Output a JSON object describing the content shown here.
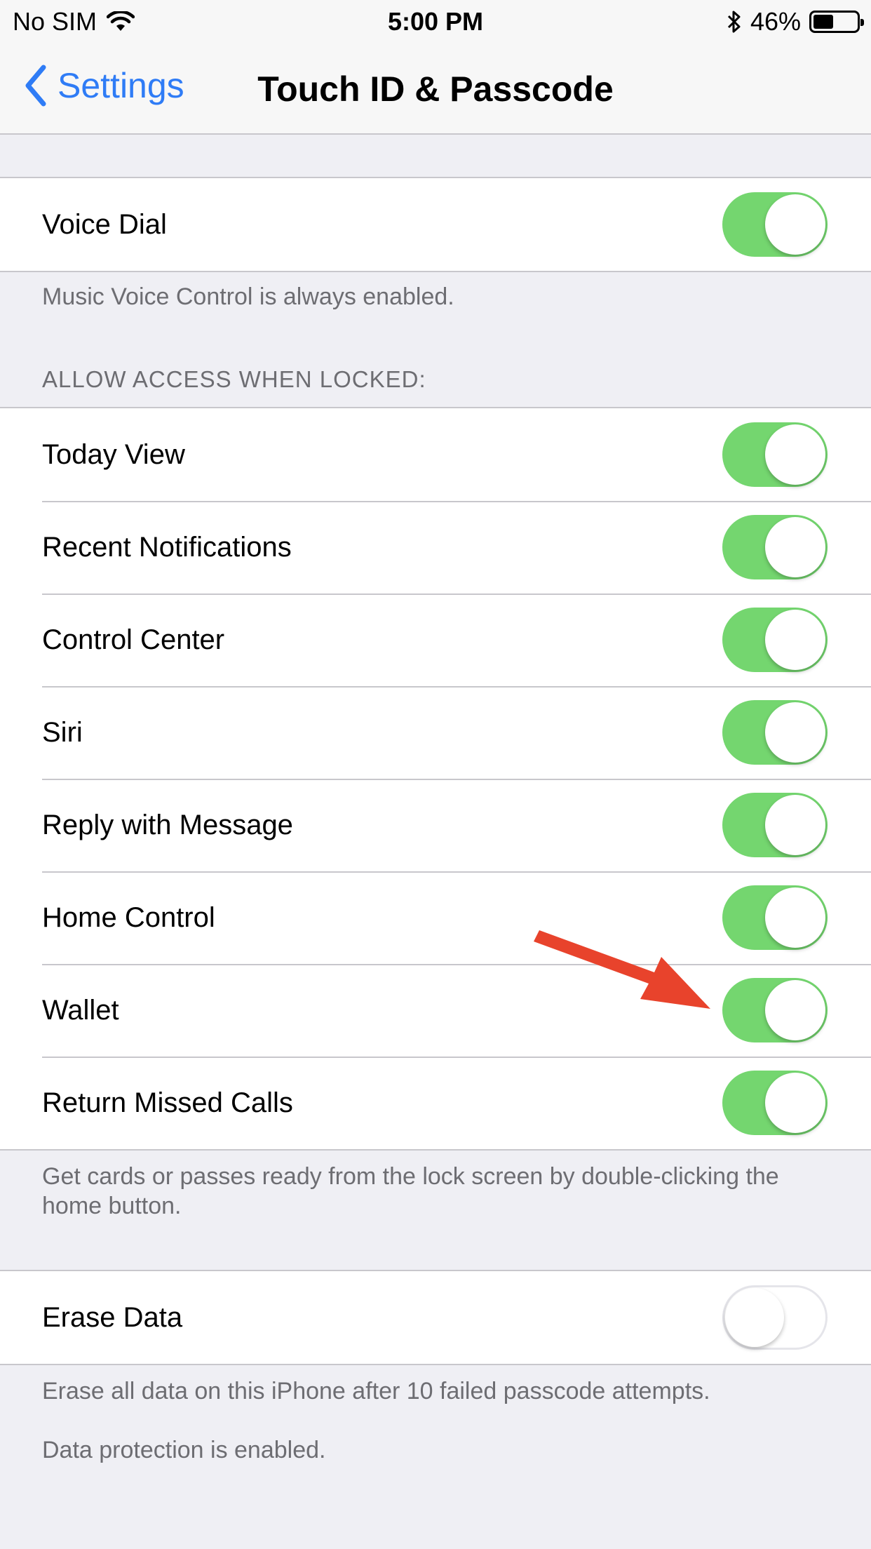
{
  "status_bar": {
    "carrier": "No SIM",
    "time": "5:00 PM",
    "battery_percent": "46%",
    "battery_level": 0.46,
    "icons": [
      "wifi-icon",
      "bluetooth-icon",
      "battery-icon"
    ]
  },
  "nav": {
    "back_label": "Settings",
    "title": "Touch ID & Passcode"
  },
  "voice_dial": {
    "label": "Voice Dial",
    "on": true,
    "footer": "Music Voice Control is always enabled."
  },
  "locked_section": {
    "header": "ALLOW ACCESS WHEN LOCKED:",
    "items": [
      {
        "label": "Today View",
        "on": true
      },
      {
        "label": "Recent Notifications",
        "on": true
      },
      {
        "label": "Control Center",
        "on": true
      },
      {
        "label": "Siri",
        "on": true
      },
      {
        "label": "Reply with Message",
        "on": true
      },
      {
        "label": "Home Control",
        "on": true
      },
      {
        "label": "Wallet",
        "on": true
      },
      {
        "label": "Return Missed Calls",
        "on": true
      }
    ],
    "footer": "Get cards or passes ready from the lock screen by double-clicking the home button."
  },
  "erase_data": {
    "label": "Erase Data",
    "on": false,
    "footer_1": "Erase all data on this iPhone after 10 failed passcode attempts.",
    "footer_2": "Data protection is enabled."
  },
  "colors": {
    "toggle_on": "#74d66f",
    "accent": "#2f7cf6",
    "arrow": "#e8432c"
  }
}
